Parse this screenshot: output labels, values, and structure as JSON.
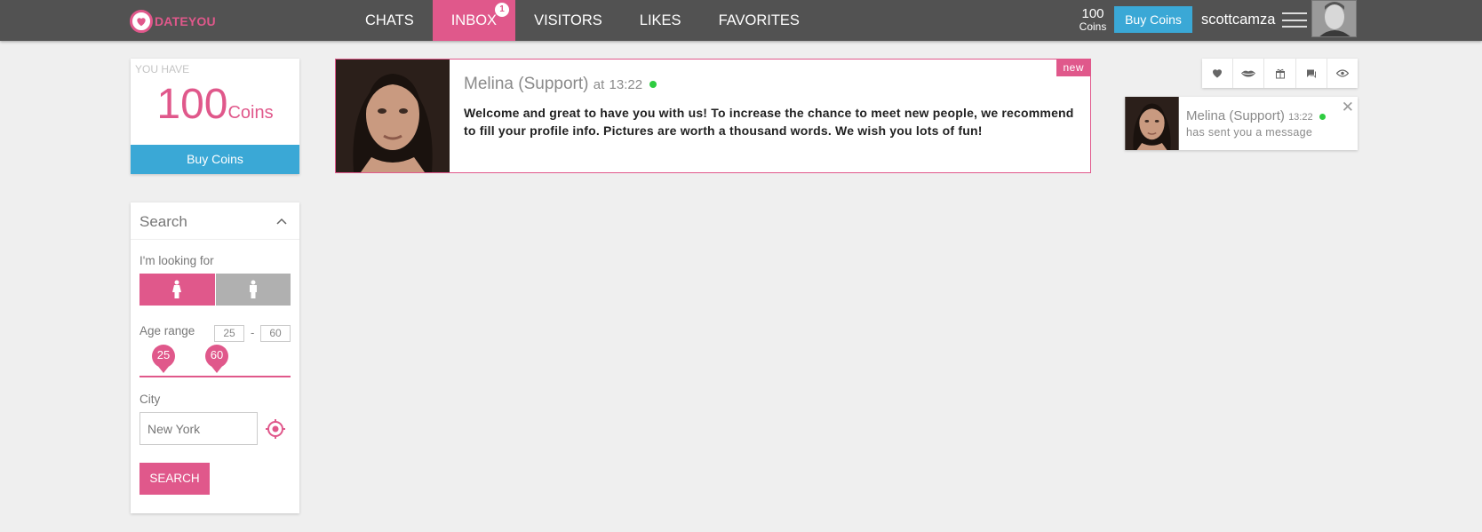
{
  "brand": {
    "name": "DATEYOU",
    "color": "#e0588b"
  },
  "nav": {
    "items": [
      {
        "label": "CHATS",
        "active": false
      },
      {
        "label": "INBOX",
        "active": true,
        "badge": "1"
      },
      {
        "label": "VISITORS",
        "active": false
      },
      {
        "label": "LIKES",
        "active": false
      },
      {
        "label": "FAVORITES",
        "active": false
      }
    ]
  },
  "header": {
    "coins_value": "100",
    "coins_label": "Coins",
    "buy_label": "Buy Coins",
    "username": "scottcamza"
  },
  "wallet": {
    "caption": "YOU HAVE",
    "amount": "100",
    "unit": "Coins",
    "buy_label": "Buy Coins"
  },
  "search": {
    "title": "Search",
    "looking_for_label": "I'm looking for",
    "looking_for_selected": "female",
    "age_label": "Age range",
    "age_min": "25",
    "age_max": "60",
    "age_dash": "-",
    "city_label": "City",
    "city_value": "New York",
    "submit_label": "SEARCH"
  },
  "message": {
    "badge": "new",
    "sender": "Melina (Support)",
    "time_prefix": "at",
    "time": "13:22",
    "online": true,
    "body": "Welcome and great to have you with us! To increase the chance to meet new people, we recommend to fill your profile info. Pictures are worth a thousand words. We wish you lots of fun!"
  },
  "quick_actions": [
    "heart-icon",
    "lips-icon",
    "gift-icon",
    "chat-icon",
    "eye-icon"
  ],
  "notification": {
    "sender": "Melina (Support)",
    "time": "13:22",
    "text": "has sent you a message",
    "close": "✕"
  },
  "colors": {
    "accent": "#e0588b",
    "blue": "#3aa8d6",
    "topbar": "#525252",
    "online": "#2ecc40"
  }
}
